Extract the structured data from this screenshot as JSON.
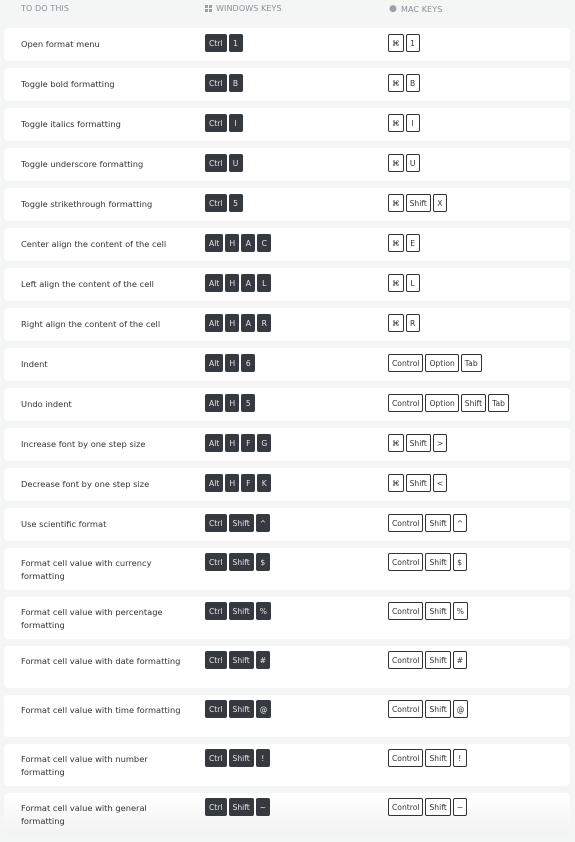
{
  "header": {
    "todo": "TO DO THIS",
    "windows": "WINDOWS KEYS",
    "windows_icon": "windows-logo-icon",
    "mac": "MAC KEYS",
    "mac_icon": "apple-logo-icon"
  },
  "shortcuts": [
    {
      "action": "Open format menu",
      "win": [
        "Ctrl",
        "1"
      ],
      "mac": [
        "⌘",
        "1"
      ]
    },
    {
      "action": "Toggle bold formatting",
      "win": [
        "Ctrl",
        "B"
      ],
      "mac": [
        "⌘",
        "B"
      ]
    },
    {
      "action": "Toggle italics formatting",
      "win": [
        "Ctrl",
        "I"
      ],
      "mac": [
        "⌘",
        "I"
      ]
    },
    {
      "action": "Toggle underscore formatting",
      "win": [
        "Ctrl",
        "U"
      ],
      "mac": [
        "⌘",
        "U"
      ]
    },
    {
      "action": "Toggle strikethrough formatting",
      "win": [
        "Ctrl",
        "5"
      ],
      "mac": [
        "⌘",
        "Shift",
        "X"
      ]
    },
    {
      "action": "Center align the content of the cell",
      "win": [
        "Alt",
        "H",
        "A",
        "C"
      ],
      "mac": [
        "⌘",
        "E"
      ]
    },
    {
      "action": "Left align the content of the cell",
      "win": [
        "Alt",
        "H",
        "A",
        "L"
      ],
      "mac": [
        "⌘",
        "L"
      ]
    },
    {
      "action": "Right align the content of the cell",
      "win": [
        "Alt",
        "H",
        "A",
        "R"
      ],
      "mac": [
        "⌘",
        "R"
      ]
    },
    {
      "action": "Indent",
      "win": [
        "Alt",
        "H",
        "6"
      ],
      "mac": [
        "Control",
        "Option",
        "Tab"
      ]
    },
    {
      "action": "Undo indent",
      "win": [
        "Alt",
        "H",
        "5"
      ],
      "mac": [
        "Control",
        "Option",
        "Shift",
        "Tab"
      ]
    },
    {
      "action": "Increase font by one step size",
      "win": [
        "Alt",
        "H",
        "F",
        "G"
      ],
      "mac": [
        "⌘",
        "Shift",
        ">"
      ]
    },
    {
      "action": "Decrease font by one step size",
      "win": [
        "Alt",
        "H",
        "F",
        "K"
      ],
      "mac": [
        "⌘",
        "Shift",
        "<"
      ]
    },
    {
      "action": "Use scientific format",
      "win": [
        "Ctrl",
        "Shift",
        "^"
      ],
      "mac": [
        "Control",
        "Shift",
        "^"
      ]
    },
    {
      "action": "Format cell value with currency formatting",
      "win": [
        "Ctrl",
        "Shift",
        "$"
      ],
      "mac": [
        "Control",
        "Shift",
        "$"
      ]
    },
    {
      "action": "Format cell value with percentage formatting",
      "win": [
        "Ctrl",
        "Shift",
        "%"
      ],
      "mac": [
        "Control",
        "Shift",
        "%"
      ]
    },
    {
      "action": "Format cell value with date formatting",
      "win": [
        "Ctrl",
        "Shift",
        "#"
      ],
      "mac": [
        "Control",
        "Shift",
        "#"
      ]
    },
    {
      "action": "Format cell value with time formatting",
      "win": [
        "Ctrl",
        "Shift",
        "@"
      ],
      "mac": [
        "Control",
        "Shift",
        "@"
      ]
    },
    {
      "action": "Format cell value with number formatting",
      "win": [
        "Ctrl",
        "Shift",
        "!"
      ],
      "mac": [
        "Control",
        "Shift",
        "!"
      ]
    },
    {
      "action": "Format cell value with general formatting",
      "win": [
        "Ctrl",
        "Shift",
        "~"
      ],
      "mac": [
        "Control",
        "Shift",
        "~"
      ]
    }
  ]
}
